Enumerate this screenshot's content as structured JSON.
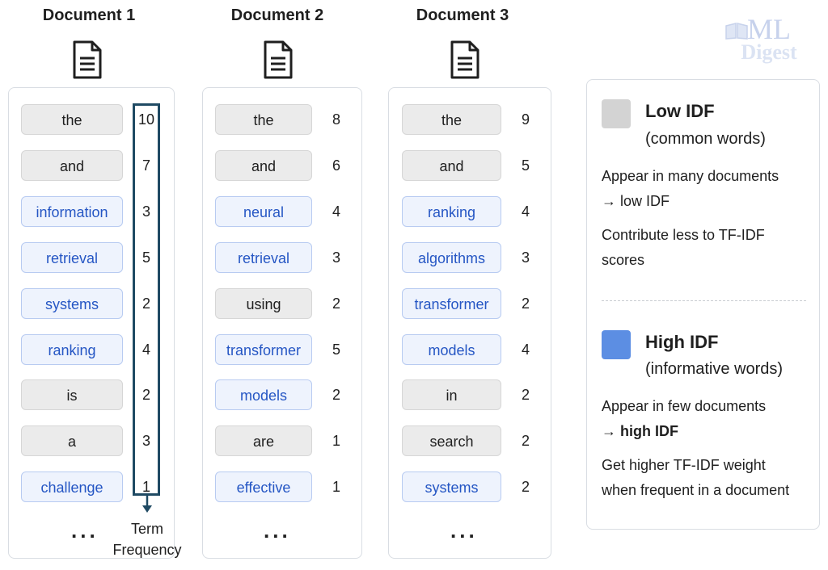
{
  "watermark": {
    "brand_top": "ML",
    "brand_bottom": "Digest"
  },
  "documents": [
    {
      "title": "Document 1",
      "rows": [
        {
          "word": "the",
          "count": "10",
          "kind": "common"
        },
        {
          "word": "and",
          "count": "7",
          "kind": "common"
        },
        {
          "word": "information",
          "count": "3",
          "kind": "informative"
        },
        {
          "word": "retrieval",
          "count": "5",
          "kind": "informative"
        },
        {
          "word": "systems",
          "count": "2",
          "kind": "informative"
        },
        {
          "word": "ranking",
          "count": "4",
          "kind": "informative"
        },
        {
          "word": "is",
          "count": "2",
          "kind": "common"
        },
        {
          "word": "a",
          "count": "3",
          "kind": "common"
        },
        {
          "word": "challenge",
          "count": "1",
          "kind": "informative"
        }
      ],
      "ellipsis": "..."
    },
    {
      "title": "Document 2",
      "rows": [
        {
          "word": "the",
          "count": "8",
          "kind": "common"
        },
        {
          "word": "and",
          "count": "6",
          "kind": "common"
        },
        {
          "word": "neural",
          "count": "4",
          "kind": "informative"
        },
        {
          "word": "retrieval",
          "count": "3",
          "kind": "informative"
        },
        {
          "word": "using",
          "count": "2",
          "kind": "common"
        },
        {
          "word": "transformer",
          "count": "5",
          "kind": "informative"
        },
        {
          "word": "models",
          "count": "2",
          "kind": "informative"
        },
        {
          "word": "are",
          "count": "1",
          "kind": "common"
        },
        {
          "word": "effective",
          "count": "1",
          "kind": "informative"
        }
      ],
      "ellipsis": "..."
    },
    {
      "title": "Document 3",
      "rows": [
        {
          "word": "the",
          "count": "9",
          "kind": "common"
        },
        {
          "word": "and",
          "count": "5",
          "kind": "common"
        },
        {
          "word": "ranking",
          "count": "4",
          "kind": "informative"
        },
        {
          "word": "algorithms",
          "count": "3",
          "kind": "informative"
        },
        {
          "word": "transformer",
          "count": "2",
          "kind": "informative"
        },
        {
          "word": "models",
          "count": "4",
          "kind": "informative"
        },
        {
          "word": "in",
          "count": "2",
          "kind": "common"
        },
        {
          "word": "search",
          "count": "2",
          "kind": "common"
        },
        {
          "word": "systems",
          "count": "2",
          "kind": "informative"
        }
      ],
      "ellipsis": "..."
    }
  ],
  "term_frequency_label": {
    "line1": "Term",
    "line2": "Frequency"
  },
  "legend": {
    "low": {
      "title": "Low IDF",
      "subtitle": "(common words)",
      "line1": "Appear in many documents",
      "line2": "→ low IDF",
      "line3": "Contribute less to TF-IDF",
      "line4": "scores",
      "color": "#d3d3d3"
    },
    "high": {
      "title": "High IDF",
      "subtitle": "(informative words)",
      "line1": "Appear in few documents",
      "line2": "→ high IDF",
      "line3": "Get higher TF-IDF weight",
      "line4": "when frequent in a document",
      "color": "#5c8ee3"
    }
  }
}
